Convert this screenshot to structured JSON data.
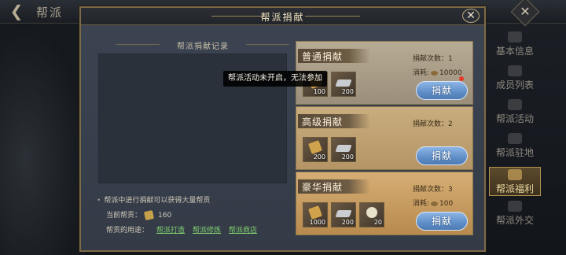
{
  "background": {
    "page_title": "帮派"
  },
  "side_tabs": [
    {
      "label": "基本信息",
      "active": false
    },
    {
      "label": "成员列表",
      "active": false
    },
    {
      "label": "帮派活动",
      "active": false
    },
    {
      "label": "帮派驻地",
      "active": false
    },
    {
      "label": "帮派福利",
      "active": true
    },
    {
      "label": "帮派外交",
      "active": false
    }
  ],
  "dialog": {
    "title": "帮派捐献",
    "close_icon": "✕"
  },
  "record": {
    "title": "帮派捐献记录",
    "tip": "帮派中进行捐献可以获得大量帮贡",
    "current_label": "当前帮贡：",
    "current_value": "160",
    "usage_label": "帮贡的用途：",
    "links": [
      "帮派打造",
      "帮派修炼",
      "帮派商店"
    ]
  },
  "cards": [
    {
      "name": "普通捐献",
      "count_label": "捐献次数：",
      "count": "1",
      "cost_label": "消耗:",
      "cost": "10000",
      "button": "捐献",
      "items": [
        {
          "icon": "gold-token-icon",
          "qty": "100"
        },
        {
          "icon": "silver-ingot-icon",
          "qty": "200"
        }
      ]
    },
    {
      "name": "高级捐献",
      "count_label": "捐献次数：",
      "count": "2",
      "button": "捐献",
      "items": [
        {
          "icon": "gold-token-icon",
          "qty": "200"
        },
        {
          "icon": "silver-ingot-icon",
          "qty": "200"
        }
      ]
    },
    {
      "name": "豪华捐献",
      "count_label": "捐献次数：",
      "count": "3",
      "cost_label": "消耗:",
      "cost": "100",
      "button": "捐献",
      "items": [
        {
          "icon": "gold-token-icon",
          "qty": "1000"
        },
        {
          "icon": "silver-ingot-icon",
          "qty": "200"
        },
        {
          "icon": "jade-icon",
          "qty": "20"
        }
      ]
    }
  ],
  "tooltip": "帮派活动未开启，无法参加"
}
